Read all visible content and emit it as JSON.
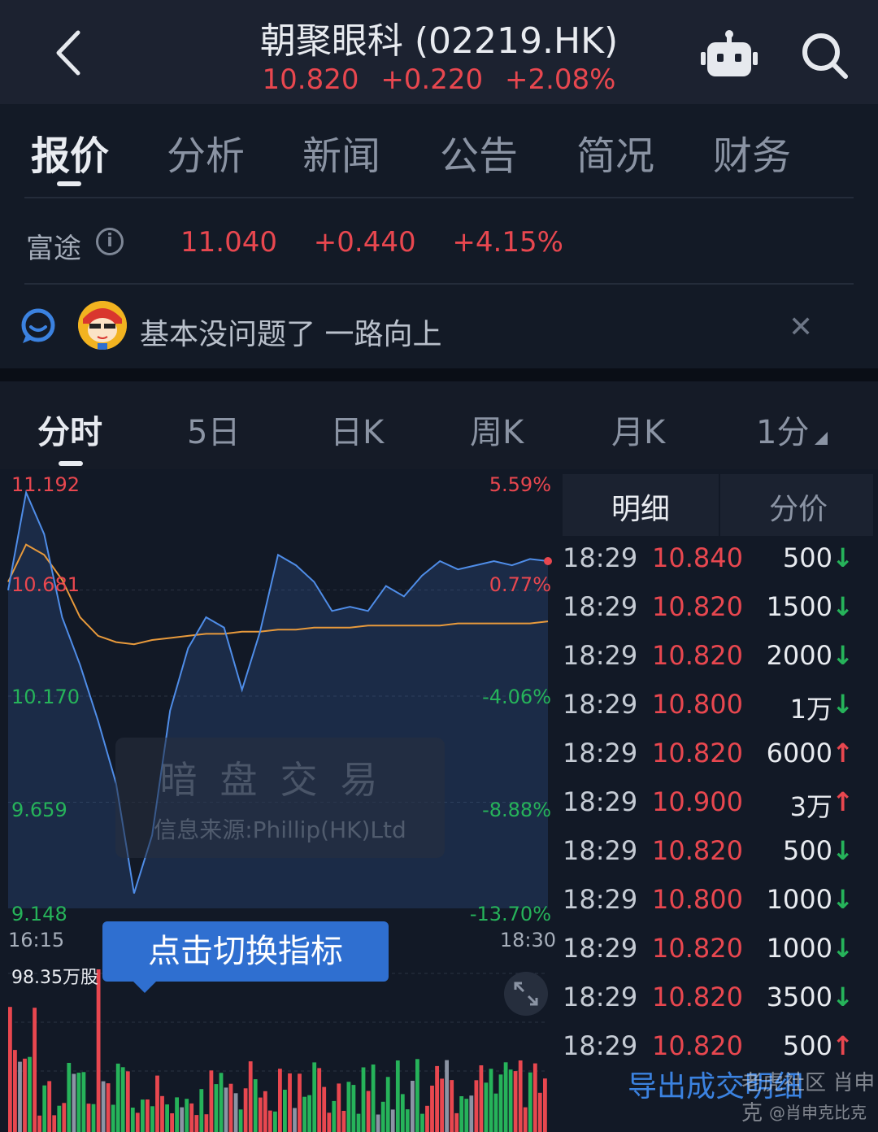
{
  "header": {
    "title": "朝聚眼科 (02219.HK)",
    "price": "10.820",
    "change": "+0.220",
    "change_pct": "+2.08%"
  },
  "tabs": [
    "报价",
    "分析",
    "新闻",
    "公告",
    "简况",
    "财务"
  ],
  "fx": {
    "label": "富途",
    "price": "11.040",
    "change": "+0.440",
    "change_pct": "+4.15%"
  },
  "comment": {
    "text": "基本没问题了 一路向上"
  },
  "ktabs": [
    "分时",
    "5日",
    "日K",
    "周K",
    "月K",
    "1分"
  ],
  "chart_data": {
    "type": "line",
    "price_labels_left": [
      "11.192",
      "10.681",
      "10.170",
      "9.659",
      "9.148"
    ],
    "pct_labels_right": [
      "5.59%",
      "0.77%",
      "-4.06%",
      "-8.88%",
      "-13.70%"
    ],
    "x_labels": [
      "16:15",
      "18:30"
    ],
    "ylim": [
      9.148,
      11.192
    ],
    "series": [
      {
        "values": [
          10.68,
          11.15,
          10.95,
          10.55,
          10.32,
          10.05,
          9.75,
          9.22,
          9.5,
          10.1,
          10.4,
          10.55,
          10.5,
          10.2,
          10.48,
          10.85,
          10.8,
          10.72,
          10.58,
          10.6,
          10.58,
          10.7,
          10.65,
          10.75,
          10.82,
          10.78,
          10.8,
          10.82,
          10.8,
          10.83,
          10.82
        ]
      },
      {
        "values": [
          10.72,
          10.9,
          10.85,
          10.73,
          10.55,
          10.46,
          10.43,
          10.42,
          10.44,
          10.45,
          10.46,
          10.47,
          10.47,
          10.48,
          10.48,
          10.49,
          10.49,
          10.5,
          10.5,
          10.5,
          10.51,
          10.51,
          10.51,
          10.51,
          10.51,
          10.52,
          10.52,
          10.52,
          10.52,
          10.52,
          10.53
        ]
      }
    ]
  },
  "overlay": {
    "watermark_title": "暗盘交易",
    "watermark_source": "信息来源:Phillip(HK)Ltd",
    "tooltip": "点击切换指标",
    "volume": "98.35万股"
  },
  "detail": {
    "tabs": [
      "明细",
      "分价"
    ],
    "rows": [
      {
        "time": "18:29",
        "price": "10.840",
        "vol": "500",
        "dir": "down"
      },
      {
        "time": "18:29",
        "price": "10.820",
        "vol": "1500",
        "dir": "down"
      },
      {
        "time": "18:29",
        "price": "10.820",
        "vol": "2000",
        "dir": "down"
      },
      {
        "time": "18:29",
        "price": "10.800",
        "vol": "1万",
        "dir": "down"
      },
      {
        "time": "18:29",
        "price": "10.820",
        "vol": "6000",
        "dir": "up"
      },
      {
        "time": "18:29",
        "price": "10.900",
        "vol": "3万",
        "dir": "up"
      },
      {
        "time": "18:29",
        "price": "10.820",
        "vol": "500",
        "dir": "down"
      },
      {
        "time": "18:29",
        "price": "10.800",
        "vol": "1000",
        "dir": "down"
      },
      {
        "time": "18:29",
        "price": "10.820",
        "vol": "1000",
        "dir": "down"
      },
      {
        "time": "18:29",
        "price": "10.820",
        "vol": "3500",
        "dir": "down"
      },
      {
        "time": "18:29",
        "price": "10.820",
        "vol": "500",
        "dir": "up"
      }
    ],
    "export": "导出成交明细"
  },
  "watermarks": {
    "brand": "老虎社区",
    "account": "肖申克",
    "handle": "@肖申克比克"
  },
  "colors": {
    "up": "#e8474f",
    "down": "#26b35a",
    "accent": "#3b82e0",
    "avg_line": "#e89a3c",
    "price_line": "#4f8de8"
  }
}
